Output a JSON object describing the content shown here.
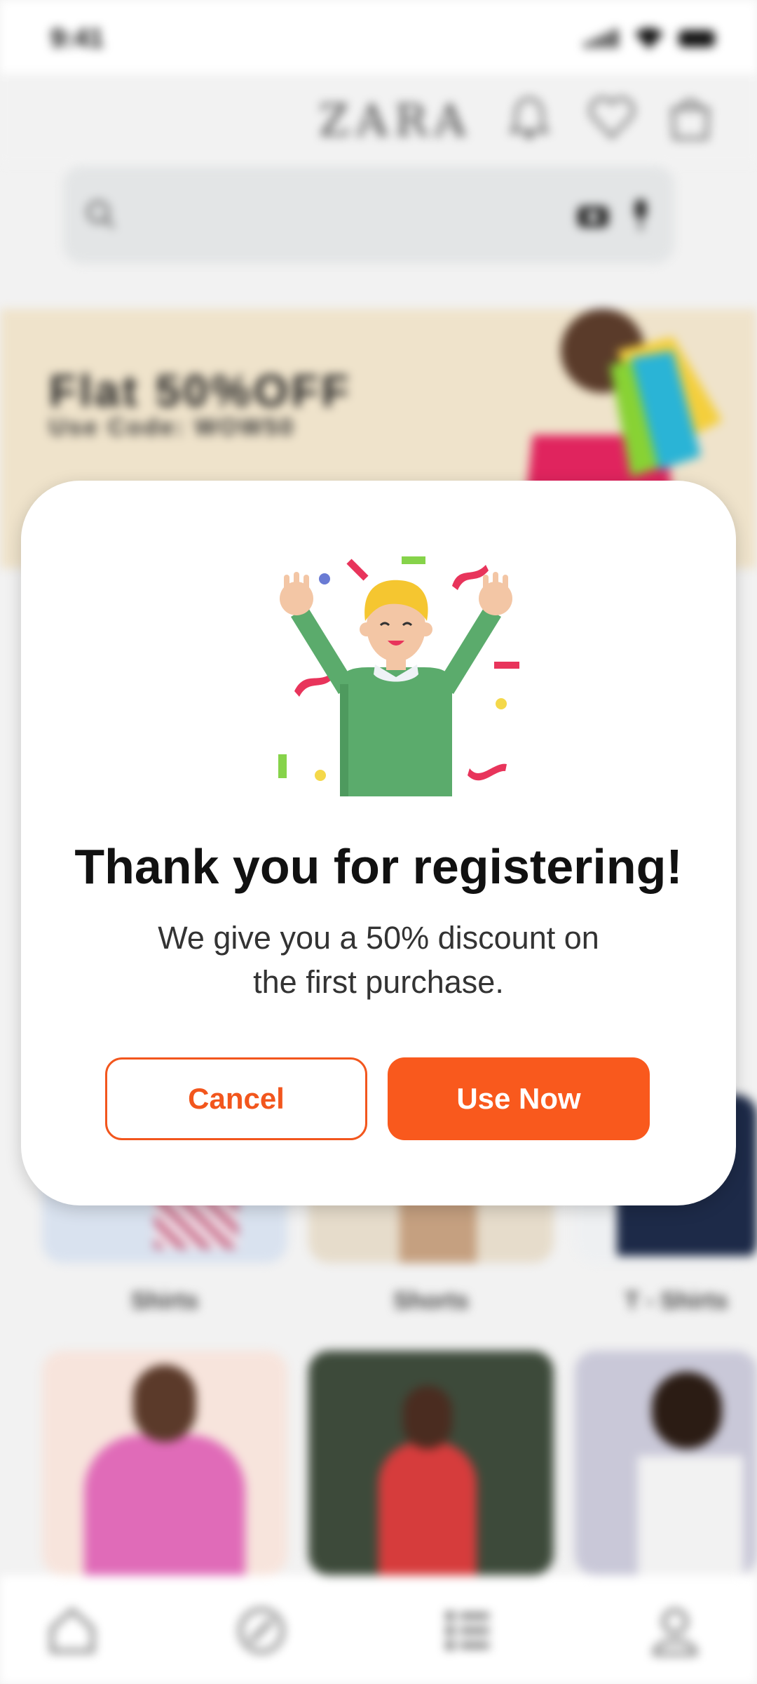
{
  "status_bar": {
    "time": "9:41"
  },
  "header": {
    "logo": "ZARA"
  },
  "banner": {
    "title": "Flat 50%OFF",
    "code": "Use Code: WOW50"
  },
  "categories": [
    {
      "label": "Shirts"
    },
    {
      "label": "Shorts"
    },
    {
      "label": "T - Shirts"
    }
  ],
  "modal": {
    "title": "Thank you for registering!",
    "message_line1": "We give you a 50% discount on",
    "message_line2": "the first purchase.",
    "cancel_label": "Cancel",
    "use_now_label": "Use Now"
  },
  "colors": {
    "accent": "#f9591d",
    "modal_bg": "#ffffff",
    "banner_bg": "#efe3cb"
  },
  "icons": {
    "header": [
      "bell-icon",
      "heart-icon",
      "bag-icon"
    ],
    "search": [
      "search-icon",
      "camera-icon",
      "mic-icon"
    ],
    "bottom_nav": [
      "home-icon",
      "compass-icon",
      "list-icon",
      "profile-icon"
    ]
  }
}
